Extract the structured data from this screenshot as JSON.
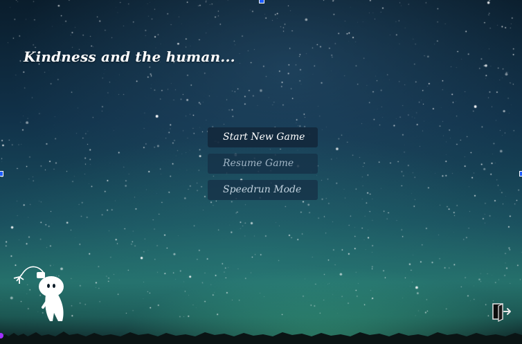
{
  "game": {
    "title": "Kindness and the human...",
    "menu": {
      "start_label": "Start New Game",
      "resume_label": "Resume Game",
      "speedrun_label": "Speedrun Mode"
    },
    "exit_icon": "exit-door-icon",
    "mascot_icon": "stick-character-icon"
  },
  "colors": {
    "title": "#ffffff",
    "button_bg": "#163248",
    "handle": "#1e5cff",
    "corner_dot": "#a030ff"
  }
}
